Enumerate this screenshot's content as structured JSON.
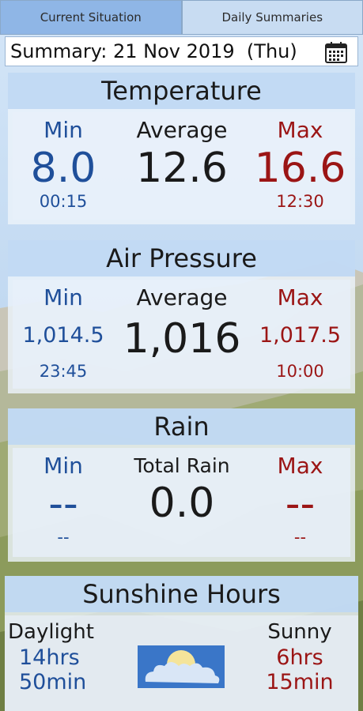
{
  "tabs": [
    {
      "label": "Current Situation",
      "active": true
    },
    {
      "label": "Daily Summaries",
      "active": false
    }
  ],
  "summary": {
    "text": "Summary: 21 Nov 2019  (Thu)",
    "icon": "calendar-icon"
  },
  "temperature": {
    "title": "Temperature",
    "min_label": "Min",
    "avg_label": "Average",
    "max_label": "Max",
    "min_value": "8.0",
    "avg_value": "12.6",
    "max_value": "16.6",
    "min_time": "00:15",
    "max_time": "12:30"
  },
  "pressure": {
    "title": "Air Pressure",
    "min_label": "Min",
    "avg_label": "Average",
    "max_label": "Max",
    "min_value": "1,014.5",
    "avg_value": "1,016",
    "max_value": "1,017.5",
    "min_time": "23:45",
    "max_time": "10:00"
  },
  "rain": {
    "title": "Rain",
    "min_label": "Min",
    "total_label": "Total Rain",
    "max_label": "Max",
    "min_value": "--",
    "total_value": "0.0",
    "max_value": "--",
    "min_time": "--",
    "max_time": "--"
  },
  "sunshine": {
    "title": "Sunshine Hours",
    "daylight_label": "Daylight",
    "daylight_hrs": "14hrs",
    "daylight_min": "50min",
    "sunny_label": "Sunny",
    "sunny_hrs": "6hrs",
    "sunny_min": "15min",
    "icon": "partly-sunny-icon"
  },
  "colors": {
    "min": "#1f4f9a",
    "max": "#9b1515",
    "tab_active": "#8fb6e6",
    "tab_inactive": "#c8dcf2"
  }
}
